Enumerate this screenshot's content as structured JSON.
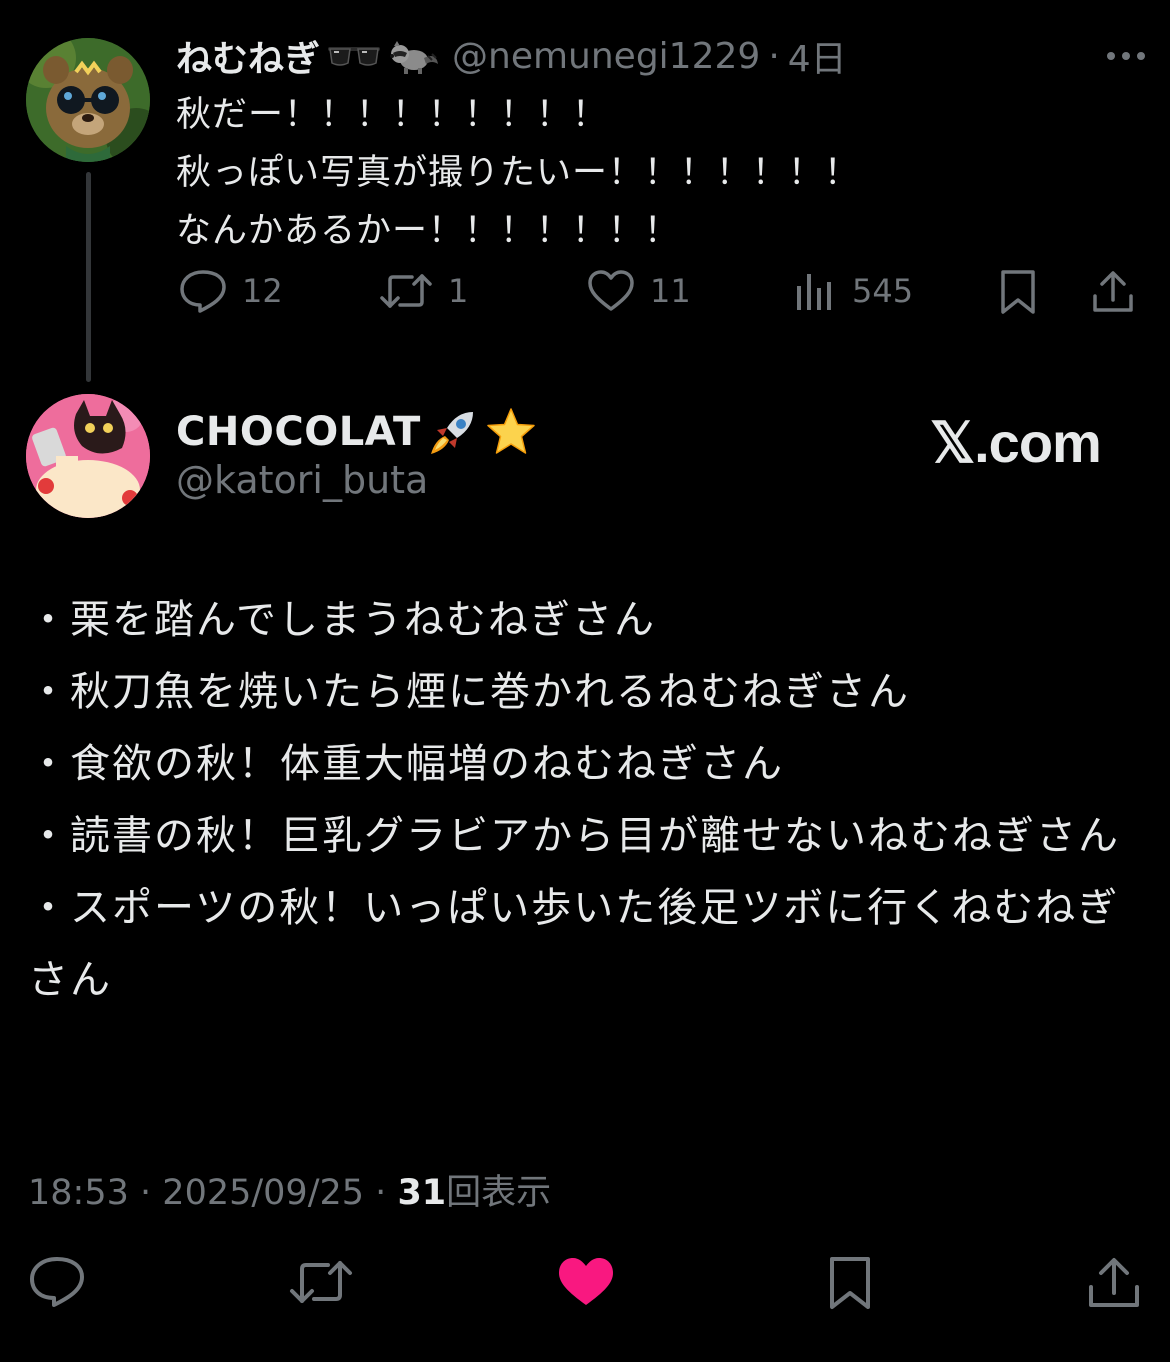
{
  "colors": {
    "background": "#000000",
    "text_primary": "#e7e9ea",
    "text_secondary": "#71767b",
    "like_active": "#f91880"
  },
  "parent_tweet": {
    "display_name": "ねむねぎ",
    "name_emojis": [
      "🕶️",
      "🦝"
    ],
    "handle": "@nemunegi1229",
    "separator": "·",
    "time": "4日",
    "lines": [
      "秋だー！！！！！！！！！",
      "秋っぽい写真が撮りたいー！！！！！！！",
      "なんかあるかー！！！！！！！"
    ],
    "metrics": {
      "replies": "12",
      "retweets": "1",
      "likes": "11",
      "views": "545"
    },
    "icons": [
      "reply-icon",
      "retweet-icon",
      "like-icon",
      "views-icon",
      "bookmark-icon",
      "share-icon",
      "more-icon"
    ]
  },
  "quote_tweet": {
    "display_name": "CHOCOLAT",
    "name_emojis": [
      "🚀",
      "⭐"
    ],
    "handle": "@katori_buta",
    "watermark": "𝕏.com",
    "lines": [
      "・栗を踏んでしまうねむねぎさん",
      "・秋刀魚を焼いたら煙に巻かれるねむねぎさん",
      "・食欲の秋！体重大幅増のねむねぎさん",
      "・読書の秋！巨乳グラビアから目が離せないねむねぎさん",
      "・スポーツの秋！いっぱい歩いた後足ツボに行くねむねぎさん"
    ],
    "meta": {
      "time": "18:53",
      "date": "2025/09/25",
      "separator": "·",
      "view_count": "31",
      "view_label": "回表示"
    },
    "liked": true
  }
}
